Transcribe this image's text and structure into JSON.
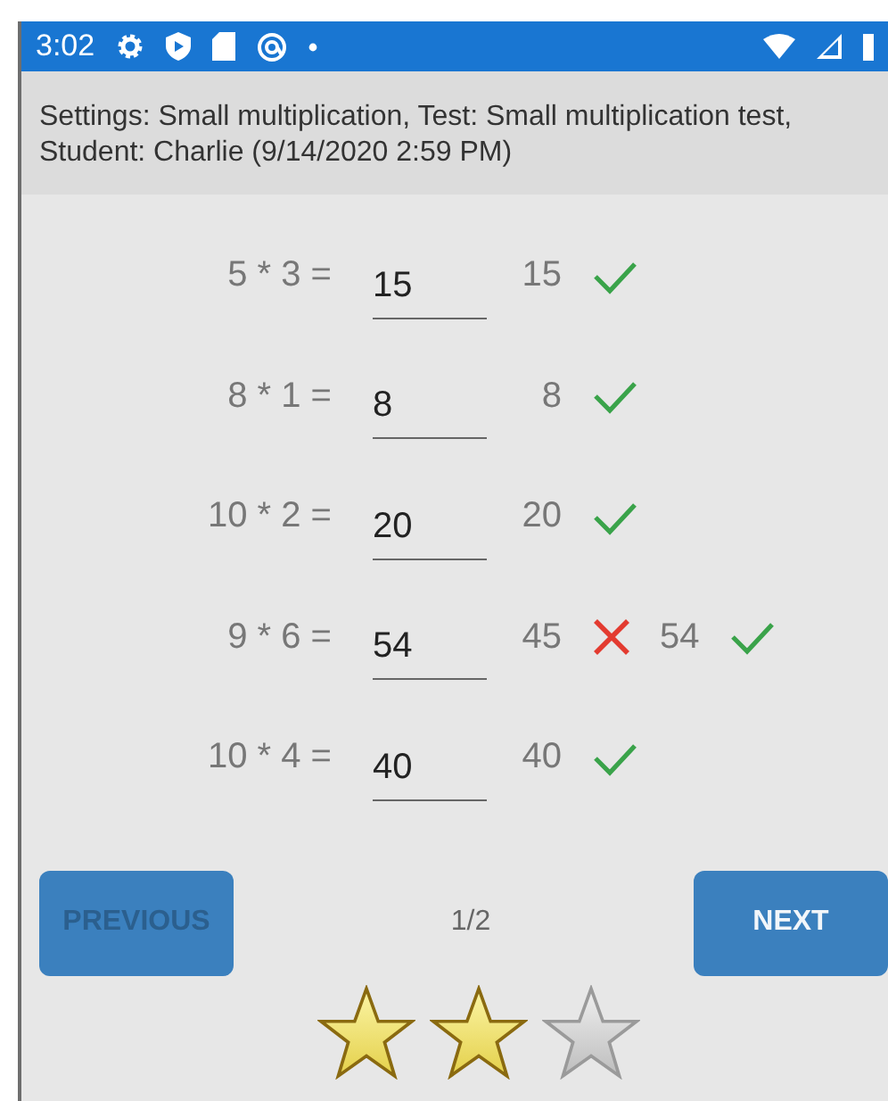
{
  "status_bar": {
    "time": "3:02"
  },
  "header": {
    "text": "Settings: Small multiplication, Test: Small multiplication test, Student: Charlie (9/14/2020 2:59 PM)"
  },
  "problems": [
    {
      "question": "5 * 3 =",
      "answer": "15",
      "results": [
        {
          "value": "15",
          "correct": true
        }
      ]
    },
    {
      "question": "8 * 1 =",
      "answer": "8",
      "results": [
        {
          "value": "8",
          "correct": true
        }
      ]
    },
    {
      "question": "10 * 2 =",
      "answer": "20",
      "results": [
        {
          "value": "20",
          "correct": true
        }
      ]
    },
    {
      "question": "9 * 6 =",
      "answer": "54",
      "results": [
        {
          "value": "45",
          "correct": false
        },
        {
          "value": "54",
          "correct": true
        }
      ]
    },
    {
      "question": "10 * 4 =",
      "answer": "40",
      "results": [
        {
          "value": "40",
          "correct": true
        }
      ]
    }
  ],
  "navigation": {
    "previous": {
      "label": "PREVIOUS",
      "disabled": true
    },
    "page": "1/2",
    "next": {
      "label": "NEXT",
      "disabled": false
    }
  },
  "rating": {
    "stars": 2
  }
}
